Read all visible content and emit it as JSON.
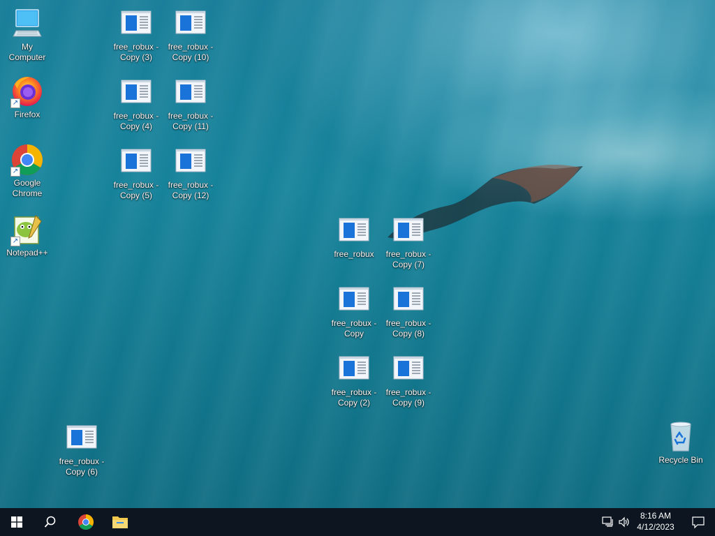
{
  "desktop": {
    "icons": [
      {
        "label": "My Computer",
        "type": "computer"
      },
      {
        "label": "Firefox",
        "type": "firefox"
      },
      {
        "label": "Google Chrome",
        "type": "chrome"
      },
      {
        "label": "Notepad++",
        "type": "notepad"
      },
      {
        "label": "free_robux - Copy (3)",
        "type": "doc"
      },
      {
        "label": "free_robux - Copy (10)",
        "type": "doc"
      },
      {
        "label": "free_robux - Copy (4)",
        "type": "doc"
      },
      {
        "label": "free_robux - Copy (11)",
        "type": "doc"
      },
      {
        "label": "free_robux - Copy (5)",
        "type": "doc"
      },
      {
        "label": "free_robux - Copy (12)",
        "type": "doc"
      },
      {
        "label": "free_robux",
        "type": "doc"
      },
      {
        "label": "free_robux - Copy (7)",
        "type": "doc"
      },
      {
        "label": "free_robux - Copy",
        "type": "doc"
      },
      {
        "label": "free_robux - Copy (8)",
        "type": "doc"
      },
      {
        "label": "free_robux - Copy (2)",
        "type": "doc"
      },
      {
        "label": "free_robux - Copy (9)",
        "type": "doc"
      },
      {
        "label": "free_robux - Copy (6)",
        "type": "doc"
      },
      {
        "label": "Recycle Bin",
        "type": "recycle"
      }
    ]
  },
  "taskbar": {
    "start_icon": "windows-logo-icon",
    "search_icon": "search-icon",
    "pinned": [
      "chrome-icon",
      "file-explorer-icon"
    ],
    "tray_icons": [
      "network-icon",
      "volume-icon"
    ],
    "time": "8:16 AM",
    "date": "4/12/2023",
    "notification_icon": "action-center-icon"
  },
  "colors": {
    "taskbar_bg": "#0d1620",
    "accent": "#1a73d9"
  }
}
